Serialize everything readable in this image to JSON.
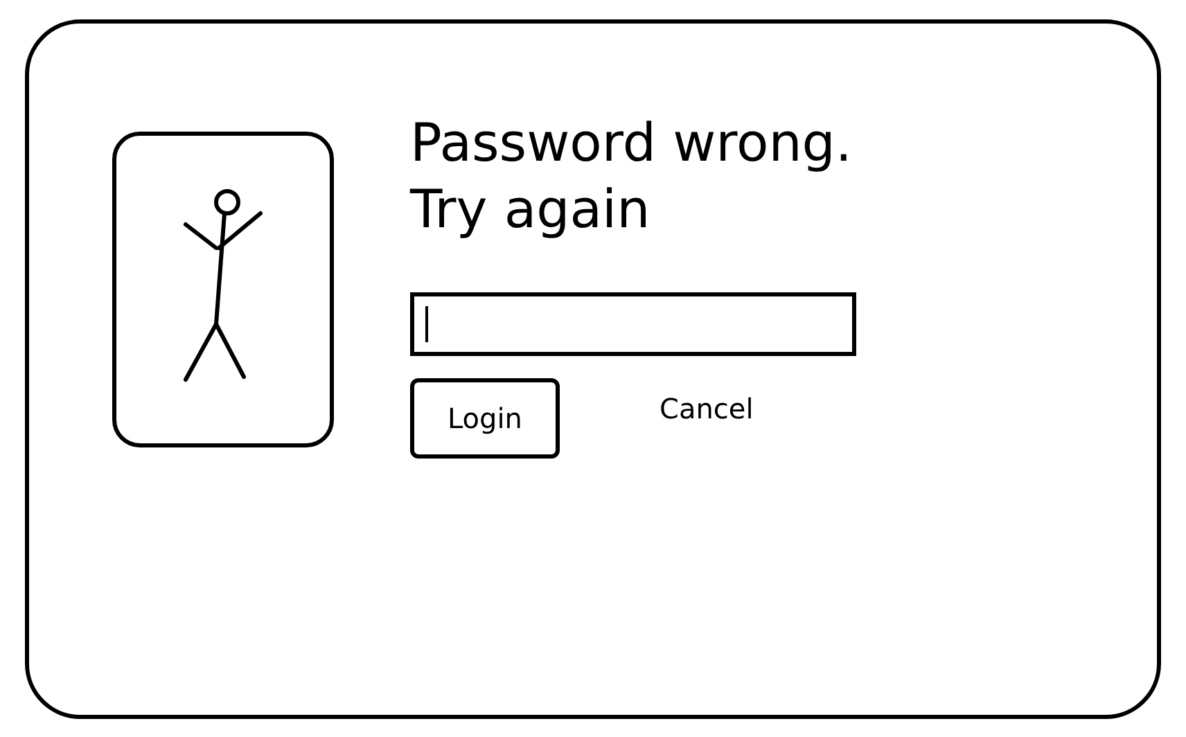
{
  "dialog": {
    "message": "Password wrong. Try again",
    "password_field": {
      "focused": true
    },
    "buttons": [
      {
        "label": "Login",
        "kind": "outlined"
      },
      {
        "label": "Cancel",
        "kind": "plain"
      }
    ]
  }
}
